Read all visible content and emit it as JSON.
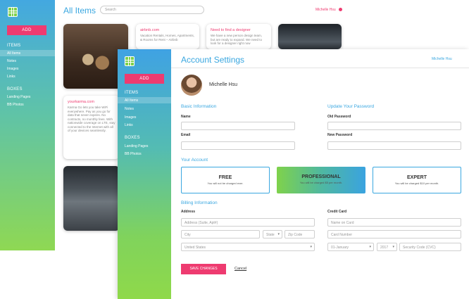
{
  "back": {
    "title": "All Items",
    "search_placeholder": "Search",
    "user_name": "Michelle Hsu",
    "sidebar": {
      "add_label": "ADD",
      "items_heading": "ITEMS",
      "items": [
        "All Items",
        "Notes",
        "Images",
        "Links"
      ],
      "boxes_heading": "BOXES",
      "boxes": [
        "Landing Pages",
        "BB Photos"
      ]
    },
    "cards": {
      "airbnb_title": "airbnb.com",
      "airbnb_text": "Vacation Rentals, Homes, Apartments, & Rooms for Rent – Airbnb",
      "designer_title": "Need to find a designer",
      "designer_text": "We have a new person design team, but are ready to expand. We need to look for a designer right now",
      "karma_title": "yourkarma.com",
      "karma_text": "Karma Go lets you take WiFi everywhere. Pay as you go for data that never expires. No contracts, no monthly fees. With nationwide coverage on LTE, stay connected to the Internet with all of your devices seamlessly."
    }
  },
  "front": {
    "title": "Account Settings",
    "user_name": "Michelle Hsu",
    "profile_name": "Michelle Hsu",
    "sidebar": {
      "add_label": "ADD",
      "items_heading": "ITEMS",
      "items": [
        "All Items",
        "Notes",
        "Images",
        "Links"
      ],
      "boxes_heading": "BOXES",
      "boxes": [
        "Landing Pages",
        "BB Photos"
      ]
    },
    "basic": {
      "heading": "Basic Information",
      "name_label": "Name",
      "email_label": "Email"
    },
    "password": {
      "heading": "Update Your Password",
      "old_label": "Old Password",
      "new_label": "New Password"
    },
    "account": {
      "heading": "Your Account",
      "plans": [
        {
          "name": "FREE",
          "desc": "You will not be charged ever."
        },
        {
          "name": "PROFESSIONAL",
          "desc": "You will be charged $5 per month."
        },
        {
          "name": "EXPERT",
          "desc": "You will be charged $10 per month."
        }
      ],
      "selected_plan": "PROFESSIONAL"
    },
    "billing": {
      "heading": "Billing Information",
      "address_label": "Address",
      "address_placeholder": "Address (Suite, Apt#)",
      "city_placeholder": "City",
      "state_value": "State",
      "zip_placeholder": "Zip Code",
      "country_value": "United States",
      "card_label": "Credit Card",
      "name_on_card_placeholder": "Name on Card",
      "card_number_placeholder": "Card Number",
      "month_value": "01-January",
      "year_value": "2017",
      "cvc_placeholder": "Security Code (CVC)"
    },
    "save_label": "SAVE CHANGES",
    "cancel_label": "Cancel"
  },
  "colors": {
    "accent_blue": "#3aa7e0",
    "accent_pink": "#ee3b70",
    "accent_green": "#7ed04b"
  }
}
